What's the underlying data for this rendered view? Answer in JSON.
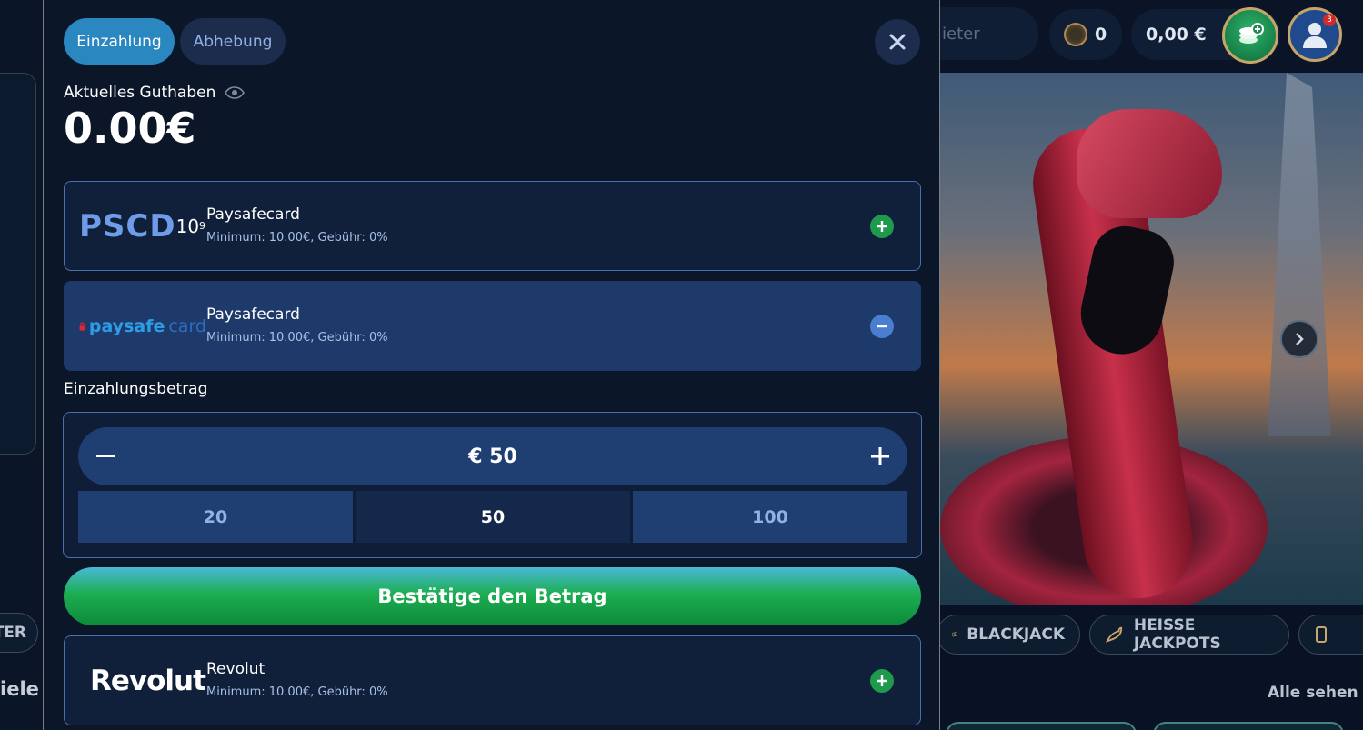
{
  "modal": {
    "tabs": [
      {
        "label": "Einzahlung",
        "active": true
      },
      {
        "label": "Abhebung",
        "active": false
      }
    ],
    "balance_label": "Aktuelles Guthaben",
    "balance_value": "0.00€",
    "payment_methods": [
      {
        "logo_text": "PSCD",
        "logo_sup": "10",
        "logo_sup2": "9",
        "name": "Paysafecard",
        "meta": "Minimum: 10.00€,  Gebühr: 0%",
        "state": "add"
      },
      {
        "logo_text": "paysafe",
        "logo_text2": "card",
        "name": "Paysafecard",
        "meta": "Minimum: 10.00€,  Gebühr: 0%",
        "state": "remove"
      },
      {
        "logo_text": "Revolut",
        "name": "Revolut",
        "meta": "Minimum: 10.00€,  Gebühr: 0%",
        "state": "add"
      }
    ],
    "amount_label": "Einzahlungsbetrag",
    "amount_value": "€ 50",
    "presets": [
      "20",
      "50",
      "100"
    ],
    "selected_preset": "50",
    "confirm_label": "Bestätige den Betrag"
  },
  "background": {
    "search_placeholder": "ieter",
    "coins_count": "0",
    "balance": "0,00 €",
    "notification_count": "3",
    "left_pill": "TER",
    "left_heading": "iele",
    "categories": [
      "BLACKJACK",
      "HEISSE JACKPOTS"
    ],
    "all_link": "Alle sehen"
  },
  "colors": {
    "modal_bg": "#0b1628",
    "accent_blue": "#2a87c0",
    "selected_card": "#1d3a6a",
    "confirm_green": "#1cae52",
    "add_green": "#1f9a4c",
    "remove_blue": "#4a7fd0"
  },
  "icons": {
    "close": "close-icon",
    "eye": "eye-icon",
    "add": "plus-circle-icon",
    "remove": "minus-circle-icon"
  }
}
